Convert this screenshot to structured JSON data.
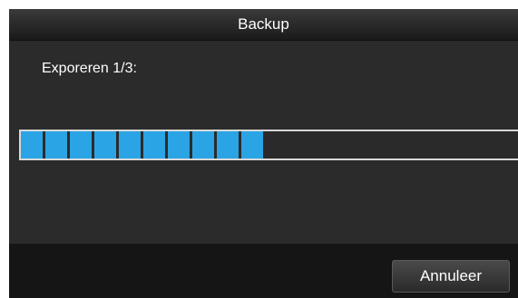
{
  "dialog": {
    "title": "Backup",
    "status_text": "Exporeren 1/3:",
    "progress": 0.49,
    "progress_color": "#2aa4e4",
    "cancel_label": "Annuleer"
  }
}
